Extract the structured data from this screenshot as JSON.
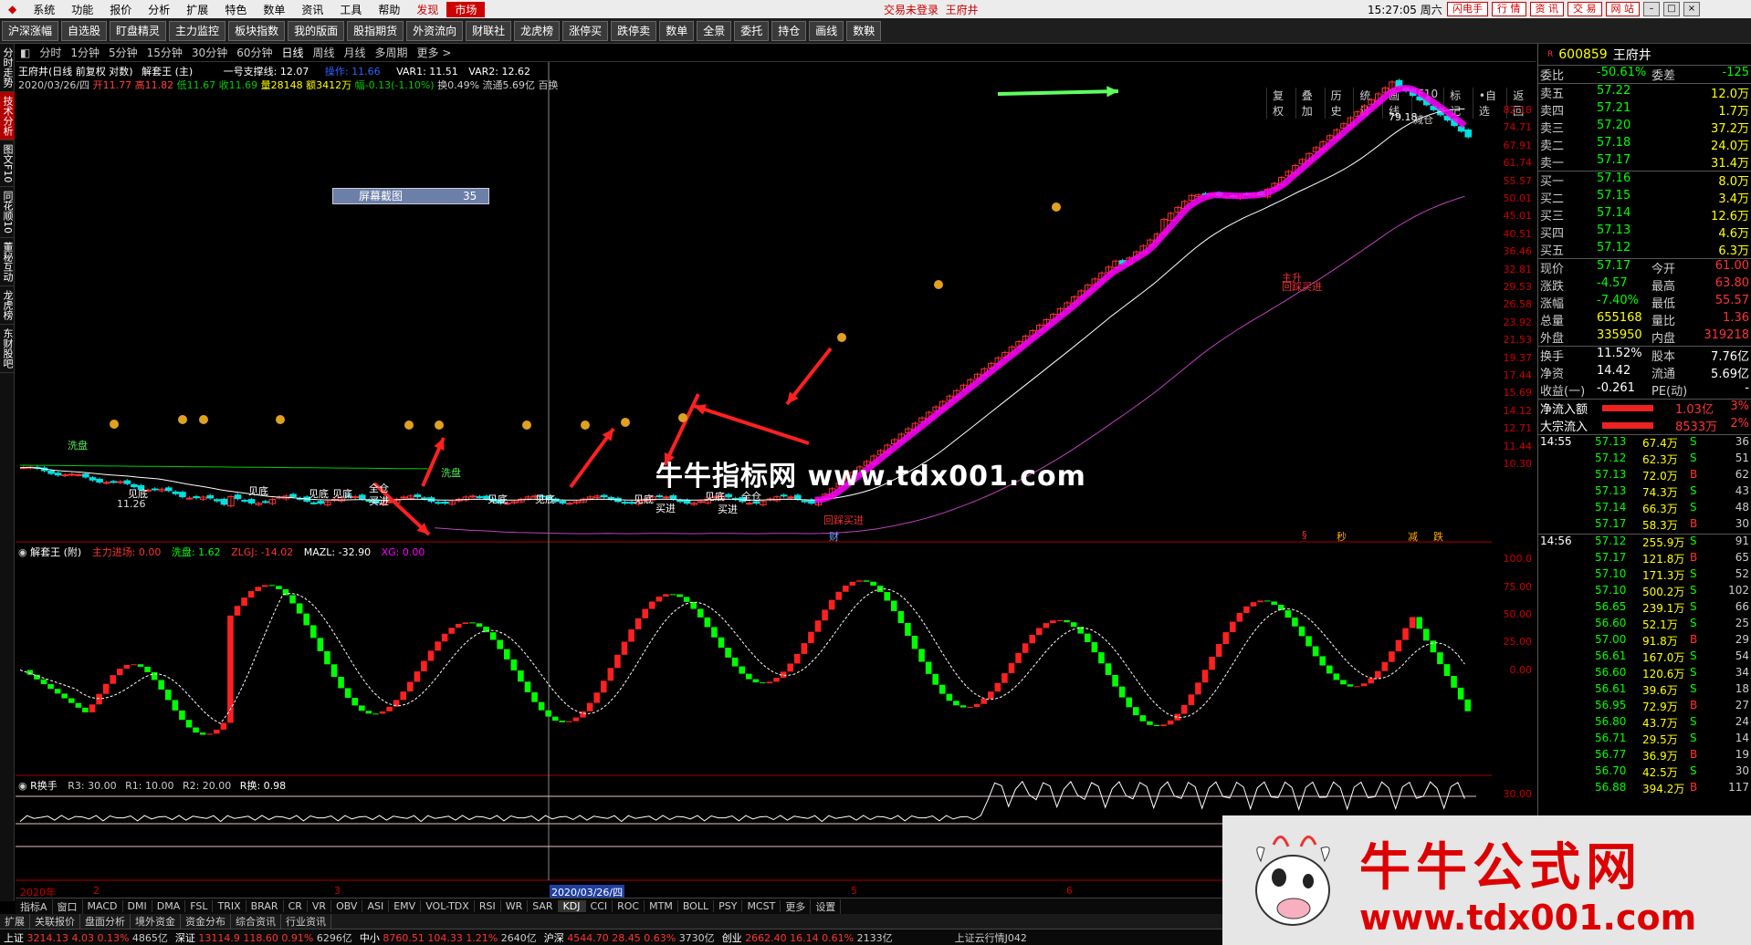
{
  "menubar": {
    "items": [
      "系统",
      "功能",
      "报价",
      "分析",
      "扩展",
      "特色",
      "数单",
      "资讯",
      "工具",
      "帮助"
    ],
    "red_items": [
      "发现",
      "市场"
    ],
    "login_status": "交易未登录",
    "stock_name": "王府井",
    "clock": "15:27:05 周六",
    "right_buttons": [
      "闪电手",
      "行 情",
      "资 讯",
      "交 易",
      "网 站"
    ],
    "win_buttons": [
      "–",
      "□",
      "×"
    ]
  },
  "toolbar": {
    "buttons": [
      "沪深涨幅",
      "自选股",
      "盯盘精灵",
      "主力监控",
      "板块指数",
      "我的版面",
      "股指期货",
      "外资流向",
      "财联社",
      "龙虎榜",
      "涨停买",
      "跌停卖",
      "数单",
      "全景",
      "委托",
      "持仓",
      "画线",
      "数鞅"
    ]
  },
  "sidebar": {
    "items": [
      "分时走势",
      "技术分析",
      "图文F10",
      "同花顺10",
      "董秘互动",
      "龙虎榜",
      "东财股吧"
    ],
    "active": 1
  },
  "periodbar": {
    "items": [
      "分时",
      "1分钟",
      "5分钟",
      "15分钟",
      "30分钟",
      "60分钟",
      "日线",
      "周线",
      "月线",
      "多周期",
      "更多 >"
    ],
    "active": "日线"
  },
  "right_tools": [
    "复权",
    "叠加",
    "历史",
    "统计",
    "画线",
    "F10",
    "标记",
    "•自选",
    "返回"
  ],
  "main_info": {
    "line1": "王府井(日线 前复权 对数)",
    "indicator": "解套王 (主)",
    "support_label": "一号支撑线: 12.07",
    "op_label": "操作: 11.66",
    "var1": "VAR1: 11.51",
    "var2": "VAR2: 12.62",
    "line2_date": "2020/03/26/四",
    "open": "开11.77",
    "high": "高11.82",
    "low": "低11.67",
    "close": "收11.69",
    "volume": "量28148",
    "amount": "额3412万",
    "change": "幅-0.13(-1.10%)",
    "turnover": "换0.49%",
    "float": "流通5.69亿",
    "extra": "百换"
  },
  "price_axis": [
    "82.18",
    "74.71",
    "67.91",
    "61.74",
    "55.57",
    "50.01",
    "45.01",
    "40.51",
    "36.46",
    "32.81",
    "29.53",
    "26.58",
    "23.92",
    "21.53",
    "19.37",
    "17.44",
    "15.69",
    "14.12",
    "12.71",
    "11.44",
    "10.30"
  ],
  "screenshot_box": {
    "label": "屏幕截图",
    "value": "35"
  },
  "annotations": {
    "xipan1": "洗盘",
    "xipan2": "洗盘",
    "jiandi": "见底",
    "quancang": "全仓",
    "mairu": "买进",
    "price_low": "11.26",
    "high_label": "79.18",
    "jian_cang": "减仓",
    "zhusheng": "主升",
    "pugui_mairu": "回踩买进",
    "cai": "财",
    "low_mark": "低",
    "bottom_tags": [
      "§",
      "秒",
      "减",
      "跌"
    ],
    "watermark": "牛牛指标网 www.tdx001.com"
  },
  "sub1": {
    "title": "解套王 (附)",
    "zhuli": "主力进场: 0.00",
    "xipan": "洗盘: 1.62",
    "zlgj": "ZLGJ: -14.02",
    "mazl": "MAZL: -32.90",
    "xg": "XG: 0.00",
    "axis": [
      "100.0",
      "75.00",
      "50.00",
      "25.00",
      "0.00"
    ]
  },
  "sub2": {
    "title": "R换手",
    "r3": "R3: 30.00",
    "r1": "R1: 10.00",
    "r2": "R2: 20.00",
    "rh": "R换: 0.98",
    "axis": [
      "30.00"
    ]
  },
  "date_axis": {
    "year": "2020年",
    "m2": "2",
    "m3": "3",
    "cursor": "2020/03/26/四",
    "m5": "5",
    "m6": "6"
  },
  "indicator_bar": [
    "指标A",
    "窗口",
    "MACD",
    "DMI",
    "DMA",
    "FSL",
    "TRIX",
    "BRAR",
    "CR",
    "VR",
    "OBV",
    "ASI",
    "EMV",
    "VOL-TDX",
    "RSI",
    "WR",
    "SAR",
    "KDJ",
    "CCI",
    "ROC",
    "MTM",
    "BOLL",
    "PSY",
    "MCST",
    "更多",
    "设置"
  ],
  "tab_bar": [
    "扩展",
    "关联报价",
    "盘面分析",
    "境外资金",
    "资金分布",
    "综合资讯",
    "行业资讯"
  ],
  "statusbar": [
    {
      "label": "上证",
      "v1": "3214.13",
      "v2": "4.03",
      "v3": "0.13%",
      "v4": "4865亿"
    },
    {
      "label": "深证",
      "v1": "13114.9",
      "v2": "118.60",
      "v3": "0.91%",
      "v4": "6296亿"
    },
    {
      "label": "中小",
      "v1": "8760.51",
      "v2": "104.33",
      "v3": "1.21%",
      "v4": "2640亿"
    },
    {
      "label": "沪深",
      "v1": "4544.70",
      "v2": "28.45",
      "v3": "0.63%",
      "v4": "3730亿"
    },
    {
      "label": "创业",
      "v1": "2662.40",
      "v2": "16.14",
      "v3": "0.61%",
      "v4": "2133亿"
    }
  ],
  "status_right": "上证云行情J042",
  "quote": {
    "code": "600859",
    "name": "王府井",
    "weibi_label": "委比",
    "weibi": "-50.61%",
    "weicha_label": "委差",
    "weicha": "-125",
    "sells": [
      {
        "label": "卖五",
        "price": "57.22",
        "vol": "12.0万"
      },
      {
        "label": "卖四",
        "price": "57.21",
        "vol": "1.7万"
      },
      {
        "label": "卖三",
        "price": "57.20",
        "vol": "37.2万"
      },
      {
        "label": "卖二",
        "price": "57.18",
        "vol": "24.0万"
      },
      {
        "label": "卖一",
        "price": "57.17",
        "vol": "31.4万"
      }
    ],
    "buys": [
      {
        "label": "买一",
        "price": "57.16",
        "vol": "8.0万"
      },
      {
        "label": "买二",
        "price": "57.15",
        "vol": "3.4万"
      },
      {
        "label": "买三",
        "price": "57.14",
        "vol": "12.6万"
      },
      {
        "label": "买四",
        "price": "57.13",
        "vol": "4.6万"
      },
      {
        "label": "买五",
        "price": "57.12",
        "vol": "6.3万"
      }
    ],
    "stats": [
      {
        "l1": "现价",
        "v1": "57.17",
        "l2": "今开",
        "v2": "61.00"
      },
      {
        "l1": "涨跌",
        "v1": "-4.57",
        "l2": "最高",
        "v2": "63.80"
      },
      {
        "l1": "涨幅",
        "v1": "-7.40%",
        "l2": "最低",
        "v2": "55.57"
      },
      {
        "l1": "总量",
        "v1": "655168",
        "l2": "量比",
        "v2": "1.36"
      },
      {
        "l1": "外盘",
        "v1": "335950",
        "l2": "内盘",
        "v2": "319218"
      }
    ],
    "stats2": [
      {
        "l1": "换手",
        "v1": "11.52%",
        "l2": "股本",
        "v2": "7.76亿"
      },
      {
        "l1": "净资",
        "v1": "14.42",
        "l2": "流通",
        "v2": "5.69亿"
      },
      {
        "l1": "收益(一)",
        "v1": "-0.261",
        "l2": "PE(动)",
        "v2": "-"
      }
    ],
    "flows": [
      {
        "label": "净流入额",
        "value": "1.03亿",
        "pct": "3%"
      },
      {
        "label": "大宗流入",
        "value": "8533万",
        "pct": "2%"
      }
    ],
    "ticks_a_time": "14:55",
    "ticks_a": [
      {
        "p": "57.13",
        "v": "67.4万",
        "s": "S",
        "n": "36"
      },
      {
        "p": "57.12",
        "v": "62.3万",
        "s": "S",
        "n": "51"
      },
      {
        "p": "57.13",
        "v": "72.0万",
        "s": "B",
        "n": "62"
      },
      {
        "p": "57.13",
        "v": "74.3万",
        "s": "S",
        "n": "43"
      },
      {
        "p": "57.14",
        "v": "66.3万",
        "s": "S",
        "n": "48"
      },
      {
        "p": "57.17",
        "v": "58.3万",
        "s": "B",
        "n": "30"
      }
    ],
    "ticks_b_time": "14:56",
    "ticks_b": [
      {
        "p": "57.12",
        "v": "255.9万",
        "s": "S",
        "n": "91"
      },
      {
        "p": "57.17",
        "v": "121.8万",
        "s": "B",
        "n": "65"
      },
      {
        "p": "57.10",
        "v": "171.3万",
        "s": "S",
        "n": "52"
      },
      {
        "p": "57.10",
        "v": "500.2万",
        "s": "S",
        "n": "102"
      },
      {
        "p": "56.65",
        "v": "239.1万",
        "s": "S",
        "n": "66"
      },
      {
        "p": "56.60",
        "v": "52.1万",
        "s": "S",
        "n": "25"
      },
      {
        "p": "57.00",
        "v": "91.8万",
        "s": "B",
        "n": "29"
      },
      {
        "p": "56.61",
        "v": "167.0万",
        "s": "S",
        "n": "54"
      },
      {
        "p": "56.60",
        "v": "120.6万",
        "s": "S",
        "n": "34"
      },
      {
        "p": "56.61",
        "v": "39.6万",
        "s": "S",
        "n": "18"
      },
      {
        "p": "56.95",
        "v": "72.9万",
        "s": "B",
        "n": "27"
      },
      {
        "p": "56.80",
        "v": "43.7万",
        "s": "S",
        "n": "24"
      },
      {
        "p": "56.71",
        "v": "29.5万",
        "s": "S",
        "n": "14"
      },
      {
        "p": "56.77",
        "v": "36.9万",
        "s": "B",
        "n": "19"
      },
      {
        "p": "56.70",
        "v": "42.5万",
        "s": "S",
        "n": "30"
      },
      {
        "p": "56.88",
        "v": "394.2万",
        "s": "B",
        "n": "117"
      }
    ]
  },
  "ad": {
    "title": "牛牛公式网",
    "url": "www.tdx001.com"
  },
  "colors": {
    "up": "#ff3030",
    "down": "#00e0e0",
    "green": "#00ff00",
    "magenta": "#ff00ff",
    "yellow": "#ffff00"
  }
}
